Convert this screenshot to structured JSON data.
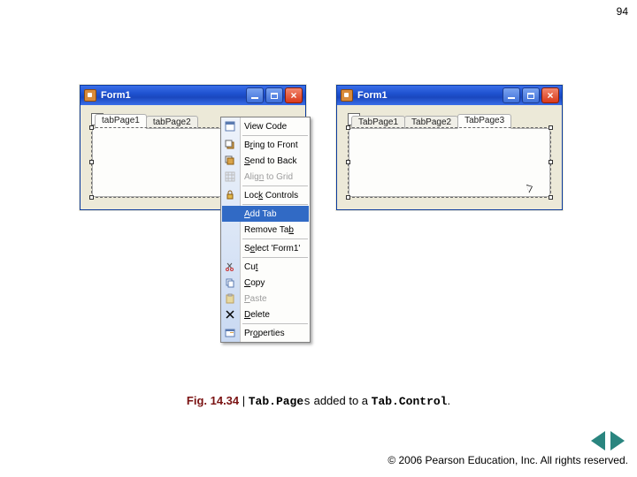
{
  "page_number": "94",
  "caption": {
    "fignum": "Fig. 14.34",
    "sep": " | ",
    "code1": "Tab.Page",
    "code1_suffix": "s",
    "mid": " added to a ",
    "code2": "Tab.Control",
    "end": "."
  },
  "footer": {
    "copyright_symbol": "©",
    "text": " 2006 Pearson Education, Inc.  All rights reserved."
  },
  "left_form": {
    "title": "Form1",
    "move_glyph": "+",
    "tabs": [
      "tabPage1",
      "tabPage2"
    ]
  },
  "right_form": {
    "title": "Form1",
    "move_glyph": "+",
    "tabs": [
      "TabPage1",
      "TabPage2",
      "TabPage3"
    ]
  },
  "context_menu_icons": {
    "view_code": "view-code-icon",
    "bring_front": "bring-to-front-icon",
    "send_back": "send-to-back-icon",
    "align_grid": "align-grid-icon",
    "lock": "lock-icon",
    "cut": "cut-icon",
    "copy": "copy-icon",
    "paste": "paste-icon",
    "delete": "delete-icon",
    "properties": "properties-icon"
  },
  "context_menu": {
    "view_code": "View Code",
    "bring_front_pre": "B",
    "bring_front_u": "r",
    "bring_front_post": "ing to Front",
    "send_back_pre": "",
    "send_back_u": "S",
    "send_back_post": "end to Back",
    "align_grid_pre": "Alig",
    "align_grid_u": "n",
    "align_grid_post": " to Grid",
    "lock_pre": "Loc",
    "lock_u": "k",
    "lock_post": " Controls",
    "add_tab_pre": "",
    "add_tab_u": "A",
    "add_tab_post": "dd Tab",
    "remove_tab_pre": "Remove Ta",
    "remove_tab_u": "b",
    "remove_tab_post": "",
    "select_pre": "S",
    "select_u": "e",
    "select_post": "lect 'Form1'",
    "cut_pre": "Cu",
    "cut_u": "t",
    "cut_post": "",
    "copy_pre": "",
    "copy_u": "C",
    "copy_post": "opy",
    "paste_pre": "",
    "paste_u": "P",
    "paste_post": "aste",
    "delete_pre": "",
    "delete_u": "D",
    "delete_post": "elete",
    "properties_pre": "Pr",
    "properties_u": "o",
    "properties_post": "perties"
  }
}
